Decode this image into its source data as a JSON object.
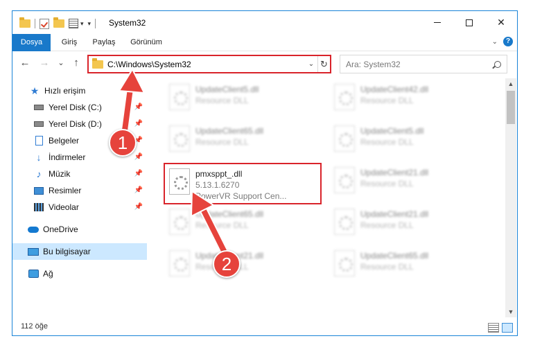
{
  "window": {
    "title": "System32",
    "close_glyph": "✕"
  },
  "ribbon": {
    "tabs": [
      "Dosya",
      "Giriş",
      "Paylaş",
      "Görünüm"
    ],
    "help_glyph": "?"
  },
  "nav": {
    "back": "←",
    "forward": "→",
    "recent": "⌄",
    "up": "↑",
    "address": "C:\\Windows\\System32",
    "search_placeholder": "Ara: System32"
  },
  "sidebar": {
    "items": [
      {
        "label": "Hızlı erişim",
        "icon": "star-icon"
      },
      {
        "label": "Yerel Disk (C:)",
        "icon": "drive-icon",
        "pinned": true
      },
      {
        "label": "Yerel Disk (D:)",
        "icon": "drive-icon",
        "pinned": true
      },
      {
        "label": "Belgeler",
        "icon": "document-icon",
        "pinned": true
      },
      {
        "label": "İndirmeler",
        "icon": "download-icon",
        "pinned": true
      },
      {
        "label": "Müzik",
        "icon": "music-icon",
        "pinned": true
      },
      {
        "label": "Resimler",
        "icon": "pictures-icon",
        "pinned": true
      },
      {
        "label": "Videolar",
        "icon": "videos-icon",
        "pinned": true
      },
      {
        "label": "OneDrive",
        "icon": "cloud-icon"
      },
      {
        "label": "Bu bilgisayar",
        "icon": "computer-icon",
        "selected": true
      },
      {
        "label": "Ağ",
        "icon": "network-icon"
      }
    ]
  },
  "files": {
    "highlighted": {
      "name": "pmxsppt_.dll",
      "version": "5.13.1.6270",
      "description": "PowerVR Support Cen..."
    },
    "left": [
      {
        "name": "UpdateClient5.dll",
        "description": "Resource DLL"
      },
      {
        "name": "UpdateClient65.dll",
        "description": "Resource DLL"
      },
      {
        "name": "UpdateClient65.dll",
        "description": "Resource DLL"
      },
      {
        "name": "UpdateClient21.dll",
        "description": "Resource DLL"
      }
    ],
    "right": [
      {
        "name": "UpdateClient42.dll",
        "description": "Resource DLL"
      },
      {
        "name": "UpdateClient5.dll",
        "description": "Resource DLL"
      },
      {
        "name": "UpdateClient21.dll",
        "description": "Resource DLL"
      },
      {
        "name": "UpdateClient21.dll",
        "description": "Resource DLL"
      },
      {
        "name": "UpdateClient65.dll",
        "description": "Resource DLL"
      }
    ]
  },
  "status": {
    "item_count": "112 öğe"
  },
  "annotations": {
    "badge1": "1",
    "badge2": "2",
    "arrow_color": "#e6433c"
  }
}
